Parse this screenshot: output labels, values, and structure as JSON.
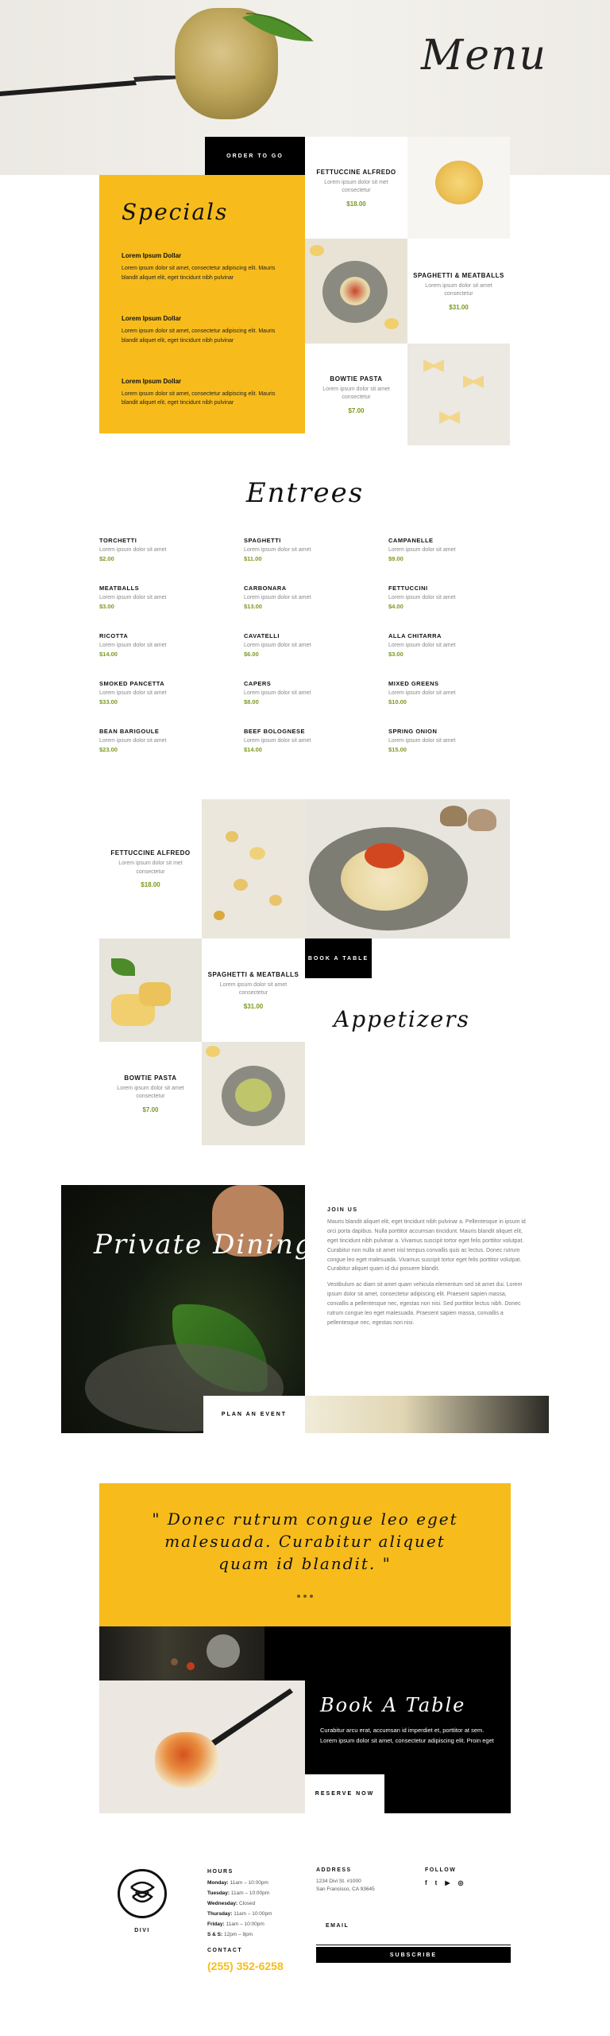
{
  "hero": {
    "title": "Menu"
  },
  "order_button": "ORDER TO GO",
  "specials": {
    "title": "Specials",
    "items": [
      {
        "name": "Lorem Ipsum Dollar",
        "text": "Lorem ipsum dolor sit amet, consectetur adipiscing elit. Mauris blandit aliquet elit, eget tincidunt nibh pulvinar"
      },
      {
        "name": "Lorem Ipsum Dollar",
        "text": "Lorem ipsum dolor sit amet, consectetur adipiscing elit. Mauris blandit aliquet elit, eget tincidunt nibh pulvinar"
      },
      {
        "name": "Lorem Ipsum Dollar",
        "text": "Lorem ipsum dolor sit amet, consectetur adipiscing elit. Mauris blandit aliquet elit, eget tincidunt nibh pulvinar"
      }
    ]
  },
  "feature_tiles": [
    {
      "name": "FETTUCCINE ALFREDO",
      "desc": "Lorem ipsum dolor sit met consectetur",
      "price": "$18.00"
    },
    {
      "name": "SPAGHETTI & MEATBALLS",
      "desc": "Lorem ipsum dolor sit amet consectetur",
      "price": "$31.00"
    },
    {
      "name": "BOWTIE PASTA",
      "desc": "Lorem ipsum dolor sit amet consectetur",
      "price": "$7.00"
    }
  ],
  "entrees": {
    "title": "Entrees",
    "items": [
      {
        "name": "TORCHETTI",
        "desc": "Lorem ipsum dolor sit amet",
        "price": "$2.00"
      },
      {
        "name": "SPAGHETTI",
        "desc": "Lorem ipsum dolor sit amet",
        "price": "$11.00"
      },
      {
        "name": "CAMPANELLE",
        "desc": "Lorem ipsum dolor sit amet",
        "price": "$9.00"
      },
      {
        "name": "MEATBALLS",
        "desc": "Lorem ipsum dolor sit amet",
        "price": "$3.00"
      },
      {
        "name": "CARBONARA",
        "desc": "Lorem ipsum dolor sit amet",
        "price": "$13.00"
      },
      {
        "name": "FETTUCCINI",
        "desc": "Lorem ipsum dolor sit amet",
        "price": "$4.00"
      },
      {
        "name": "RICOTTA",
        "desc": "Lorem ipsum dolor sit amet",
        "price": "$14.00"
      },
      {
        "name": "CAVATELLI",
        "desc": "Lorem ipsum dolor sit amet",
        "price": "$6.00"
      },
      {
        "name": "ALLA CHITARRA",
        "desc": "Lorem ipsum dolor sit amet",
        "price": "$3.00"
      },
      {
        "name": "SMOKED PANCETTA",
        "desc": "Lorem ipsum dolor sit amet",
        "price": "$33.00"
      },
      {
        "name": "CAPERS",
        "desc": "Lorem ipsum dolor sit amet",
        "price": "$8.00"
      },
      {
        "name": "MIXED GREENS",
        "desc": "Lorem ipsum dolor sit amet",
        "price": "$10.00"
      },
      {
        "name": "BEAN BARIGOULE",
        "desc": "Lorem ipsum dolor sit amet",
        "price": "$23.00"
      },
      {
        "name": "BEEF BOLOGNESE",
        "desc": "Lorem ipsum dolor sit amet",
        "price": "$14.00"
      },
      {
        "name": "SPRING ONION",
        "desc": "Lorem ipsum dolor sit amet",
        "price": "$15.00"
      }
    ]
  },
  "appetizers": {
    "title": "Appetizers",
    "book_button": "BOOK A TABLE",
    "tiles": [
      {
        "name": "FETTUCCINE ALFREDO",
        "desc": "Lorem ipsum dolor sit met consectetur",
        "price": "$18.00"
      },
      {
        "name": "SPAGHETTI & MEATBALLS",
        "desc": "Lorem ipsum dolor sit amet consectetur",
        "price": "$31.00"
      },
      {
        "name": "BOWTIE PASTA",
        "desc": "Lorem ipsum dolor sit amet consectetur",
        "price": "$7.00"
      }
    ]
  },
  "private_dining": {
    "title": "Private Dining",
    "button": "PLAN AN EVENT",
    "heading": "JOIN US",
    "p1": "Mauris blandit aliquet elit, eget tincidunt nibh pulvinar a. Pellentesque in ipsum id orci porta dapibus. Nulla porttitor accumsan tincidunt. Mauris blandit aliquet elit, eget tincidunt nibh pulvinar a. Vivamus suscipit tortor eget felis porttitor volutpat. Curabitur non nulla sit amet nisl tempus convallis quis ac lectus. Donec rutrum congue leo eget malesuada. Vivamus suscipit tortor eget felis porttitor volutpat. Curabitur aliquet quam id dui posuere blandit.",
    "p2": "Vestibulum ac diam sit amet quam vehicula elementum sed sit amet dui. Lorem ipsum dolor sit amet, consectetur adipiscing elit. Praesent sapien massa, convallis a pellentesque nec, egestas non nisi. Sed porttitor lectus nibh. Donec rutrum congue leo eget malesuada. Praesent sapien massa, convallis a pellentesque nec, egestas non nisi."
  },
  "quote": {
    "text": "\" Donec rutrum congue leo eget malesuada. Curabitur aliquet quam id blandit. \""
  },
  "book": {
    "title": "Book A Table",
    "text": "Curabitur arcu erat, accumsan id imperdiet et, porttitor at sem. Lorem ipsum dolor sit amet, consectetur adipiscing elit. Proin eget",
    "button": "RESERVE NOW"
  },
  "footer": {
    "brand": "DIVI",
    "hours_label": "HOURS",
    "hours": [
      {
        "day": "Monday:",
        "time": "11am – 10:00pm"
      },
      {
        "day": "Tuesday:",
        "time": "11am – 10:00pm"
      },
      {
        "day": "Wednesday:",
        "time": "Closed"
      },
      {
        "day": "Thursday:",
        "time": "11am – 10:00pm"
      },
      {
        "day": "Friday:",
        "time": "11am – 10:00pm"
      },
      {
        "day": "S & S:",
        "time": "12pm – 8pm"
      }
    ],
    "contact_label": "CONTACT",
    "phone": "(255) 352-6258",
    "address_label": "ADDRESS",
    "address_line1": "1234 Divi St. #1000",
    "address_line2": "San Francisco, CA 93645",
    "follow_label": "FOLLOW",
    "social": [
      "f",
      "t",
      "▶",
      "◎"
    ],
    "email_label": "EMAIL",
    "subscribe": "SUBSCRIBE"
  },
  "colors": {
    "accent": "#f7bc1c",
    "price": "#7a9a1f",
    "dark": "#000000"
  }
}
